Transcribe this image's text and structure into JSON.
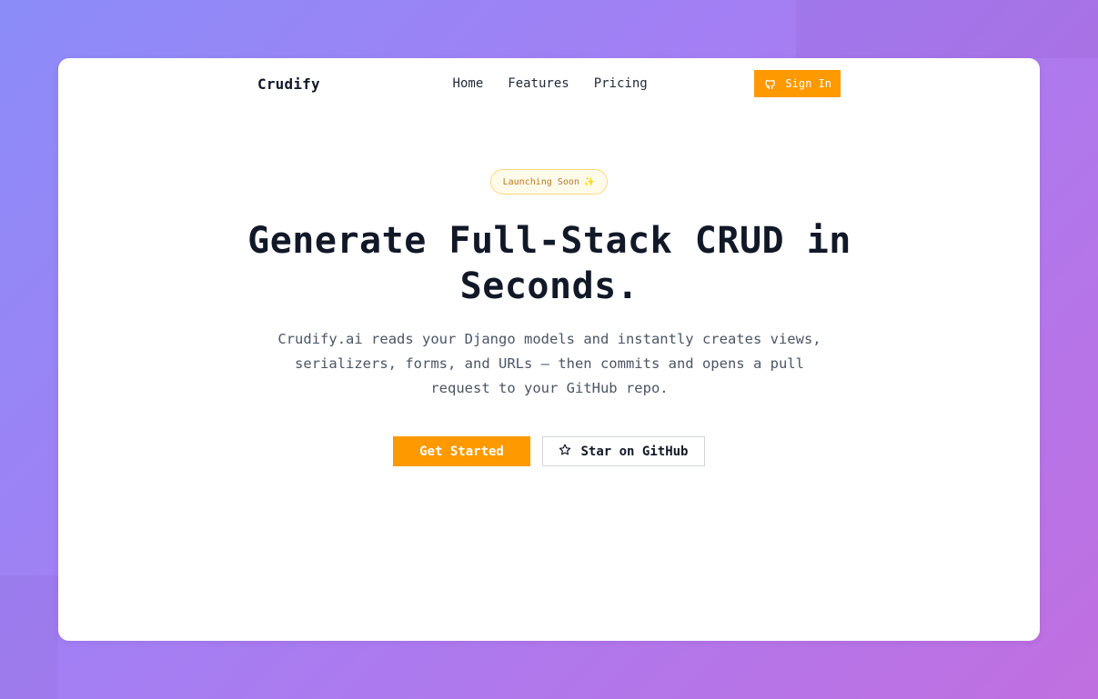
{
  "nav": {
    "logo": "Crudify",
    "links": [
      "Home",
      "Features",
      "Pricing"
    ],
    "signin_label": "Sign In",
    "signin_icon": "github-icon"
  },
  "hero": {
    "badge": "Launching Soon",
    "badge_icon": "✨",
    "title_line1": "Generate Full-Stack CRUD in",
    "title_line2": "Seconds.",
    "subtitle_line1": "Crudify.ai reads your Django models and instantly creates views,",
    "subtitle_line2": "serializers, forms, and URLs — then commits and opens a pull",
    "subtitle_line3": "request to your GitHub repo.",
    "primary_cta": "Get Started",
    "secondary_cta": "Star on GitHub",
    "secondary_icon": "star-icon"
  },
  "colors": {
    "accent": "#ff9900",
    "text": "#111827",
    "badge_border": "#fcd980",
    "badge_text": "#b7791f"
  }
}
